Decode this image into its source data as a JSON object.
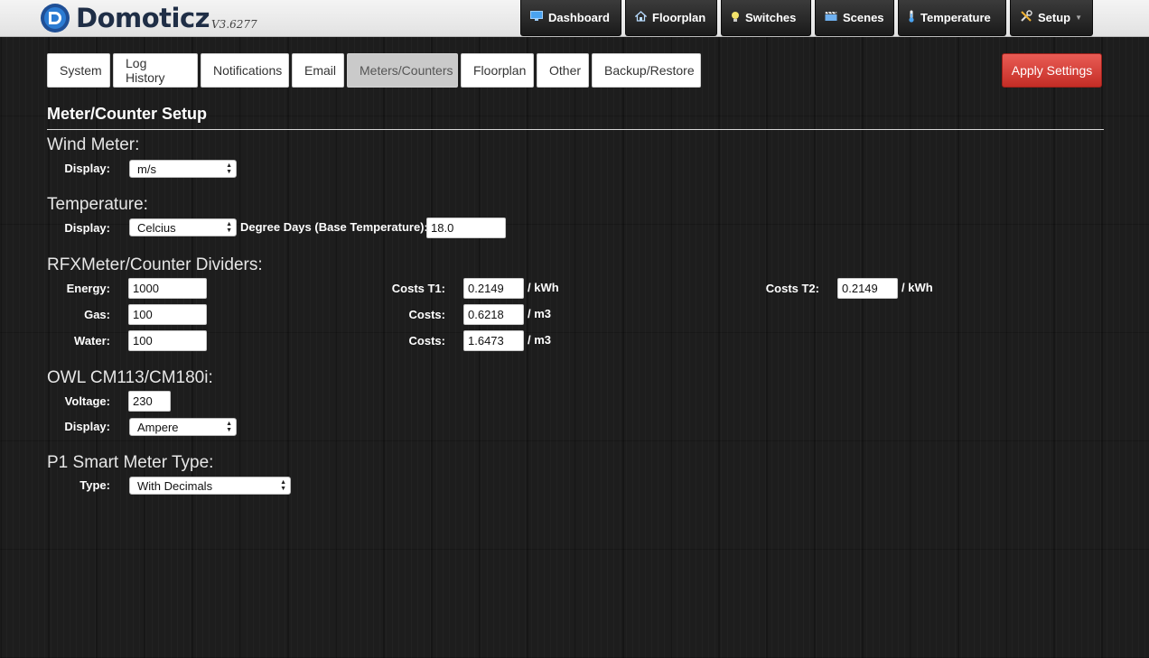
{
  "app": {
    "name": "Domoticz",
    "version": "V3.6277"
  },
  "nav": [
    {
      "label": "Dashboard",
      "icon": "monitor-icon"
    },
    {
      "label": "Floorplan",
      "icon": "house-icon"
    },
    {
      "label": "Switches",
      "icon": "lightbulb-icon"
    },
    {
      "label": "Scenes",
      "icon": "scene-icon"
    },
    {
      "label": "Temperature",
      "icon": "thermometer-icon"
    },
    {
      "label": "Setup",
      "icon": "tools-icon"
    }
  ],
  "tabs": [
    "System",
    "Log History",
    "Notifications",
    "Email",
    "Meters/Counters",
    "Floorplan",
    "Other",
    "Backup/Restore"
  ],
  "active_tab": "Meters/Counters",
  "apply_label": "Apply Settings",
  "page_title": "Meter/Counter Setup",
  "wind": {
    "heading": "Wind Meter:",
    "display_label": "Display:",
    "display_value": "m/s"
  },
  "temperature": {
    "heading": "Temperature:",
    "display_label": "Display:",
    "display_value": "Celcius",
    "degree_days_label": "Degree Days (Base Temperature):",
    "degree_days_value": "18.0"
  },
  "rfx": {
    "heading": "RFXMeter/Counter Dividers:",
    "energy_label": "Energy:",
    "energy_value": "1000",
    "gas_label": "Gas:",
    "gas_value": "100",
    "water_label": "Water:",
    "water_value": "100",
    "costs_t1_label": "Costs T1:",
    "costs_t1_value": "0.2149",
    "costs_t1_unit": "/ kWh",
    "costs_t2_label": "Costs T2:",
    "costs_t2_value": "0.2149",
    "costs_t2_unit": "/ kWh",
    "gas_costs_label": "Costs:",
    "gas_costs_value": "0.6218",
    "gas_costs_unit": "/ m3",
    "water_costs_label": "Costs:",
    "water_costs_value": "1.6473",
    "water_costs_unit": "/ m3"
  },
  "owl": {
    "heading": "OWL CM113/CM180i:",
    "voltage_label": "Voltage:",
    "voltage_value": "230",
    "display_label": "Display:",
    "display_value": "Ampere"
  },
  "p1": {
    "heading": "P1 Smart Meter Type:",
    "type_label": "Type:",
    "type_value": "With Decimals"
  }
}
